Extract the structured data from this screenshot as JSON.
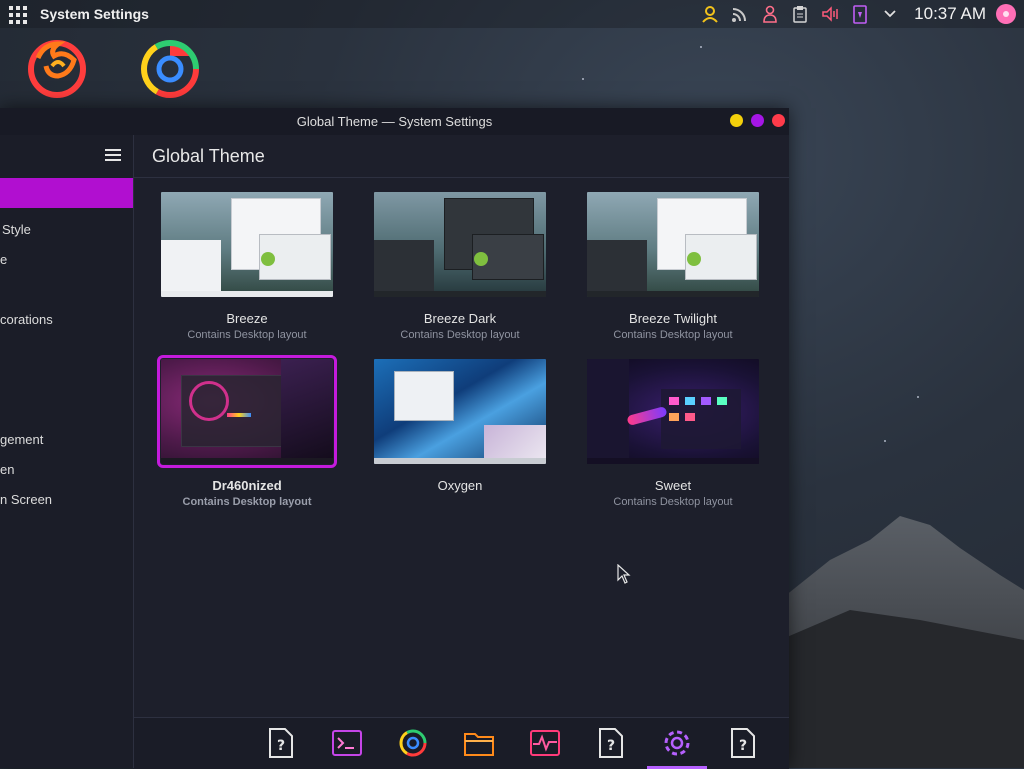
{
  "top_panel": {
    "active_app": "System Settings",
    "clock": "10:37 AM",
    "tray_icons": [
      "user-icon",
      "rss-icon",
      "person-icon",
      "clipboard-icon",
      "volume-icon",
      "battery-icon",
      "chevron-down-icon"
    ]
  },
  "desktop_icons": [
    "firefox-icon",
    "chrome-icon"
  ],
  "window": {
    "title": "Global Theme — System Settings",
    "content_title": "Global Theme",
    "sidebar_items": [
      "Style",
      "e",
      "corations",
      "gement",
      "en",
      "n Screen"
    ]
  },
  "themes": [
    {
      "name": "Breeze",
      "subtitle": "Contains Desktop layout",
      "selected": false
    },
    {
      "name": "Breeze Dark",
      "subtitle": "Contains Desktop layout",
      "selected": false
    },
    {
      "name": "Breeze Twilight",
      "subtitle": "Contains Desktop layout",
      "selected": false
    },
    {
      "name": "Dr460nized",
      "subtitle": "Contains Desktop layout",
      "selected": true
    },
    {
      "name": "Oxygen",
      "subtitle": "",
      "selected": false
    },
    {
      "name": "Sweet",
      "subtitle": "Contains Desktop layout",
      "selected": false
    }
  ],
  "dock": {
    "icons": [
      "unknown-app-icon",
      "terminal-icon",
      "chrome-icon",
      "folder-icon",
      "system-monitor-icon",
      "unknown-app-icon",
      "settings-icon",
      "unknown-app-icon"
    ],
    "active": "settings-icon"
  },
  "colors": {
    "accent": "#b10fd0",
    "close": "#ff3b4a",
    "maximize": "#a516e6",
    "minimize": "#f3d00b"
  }
}
